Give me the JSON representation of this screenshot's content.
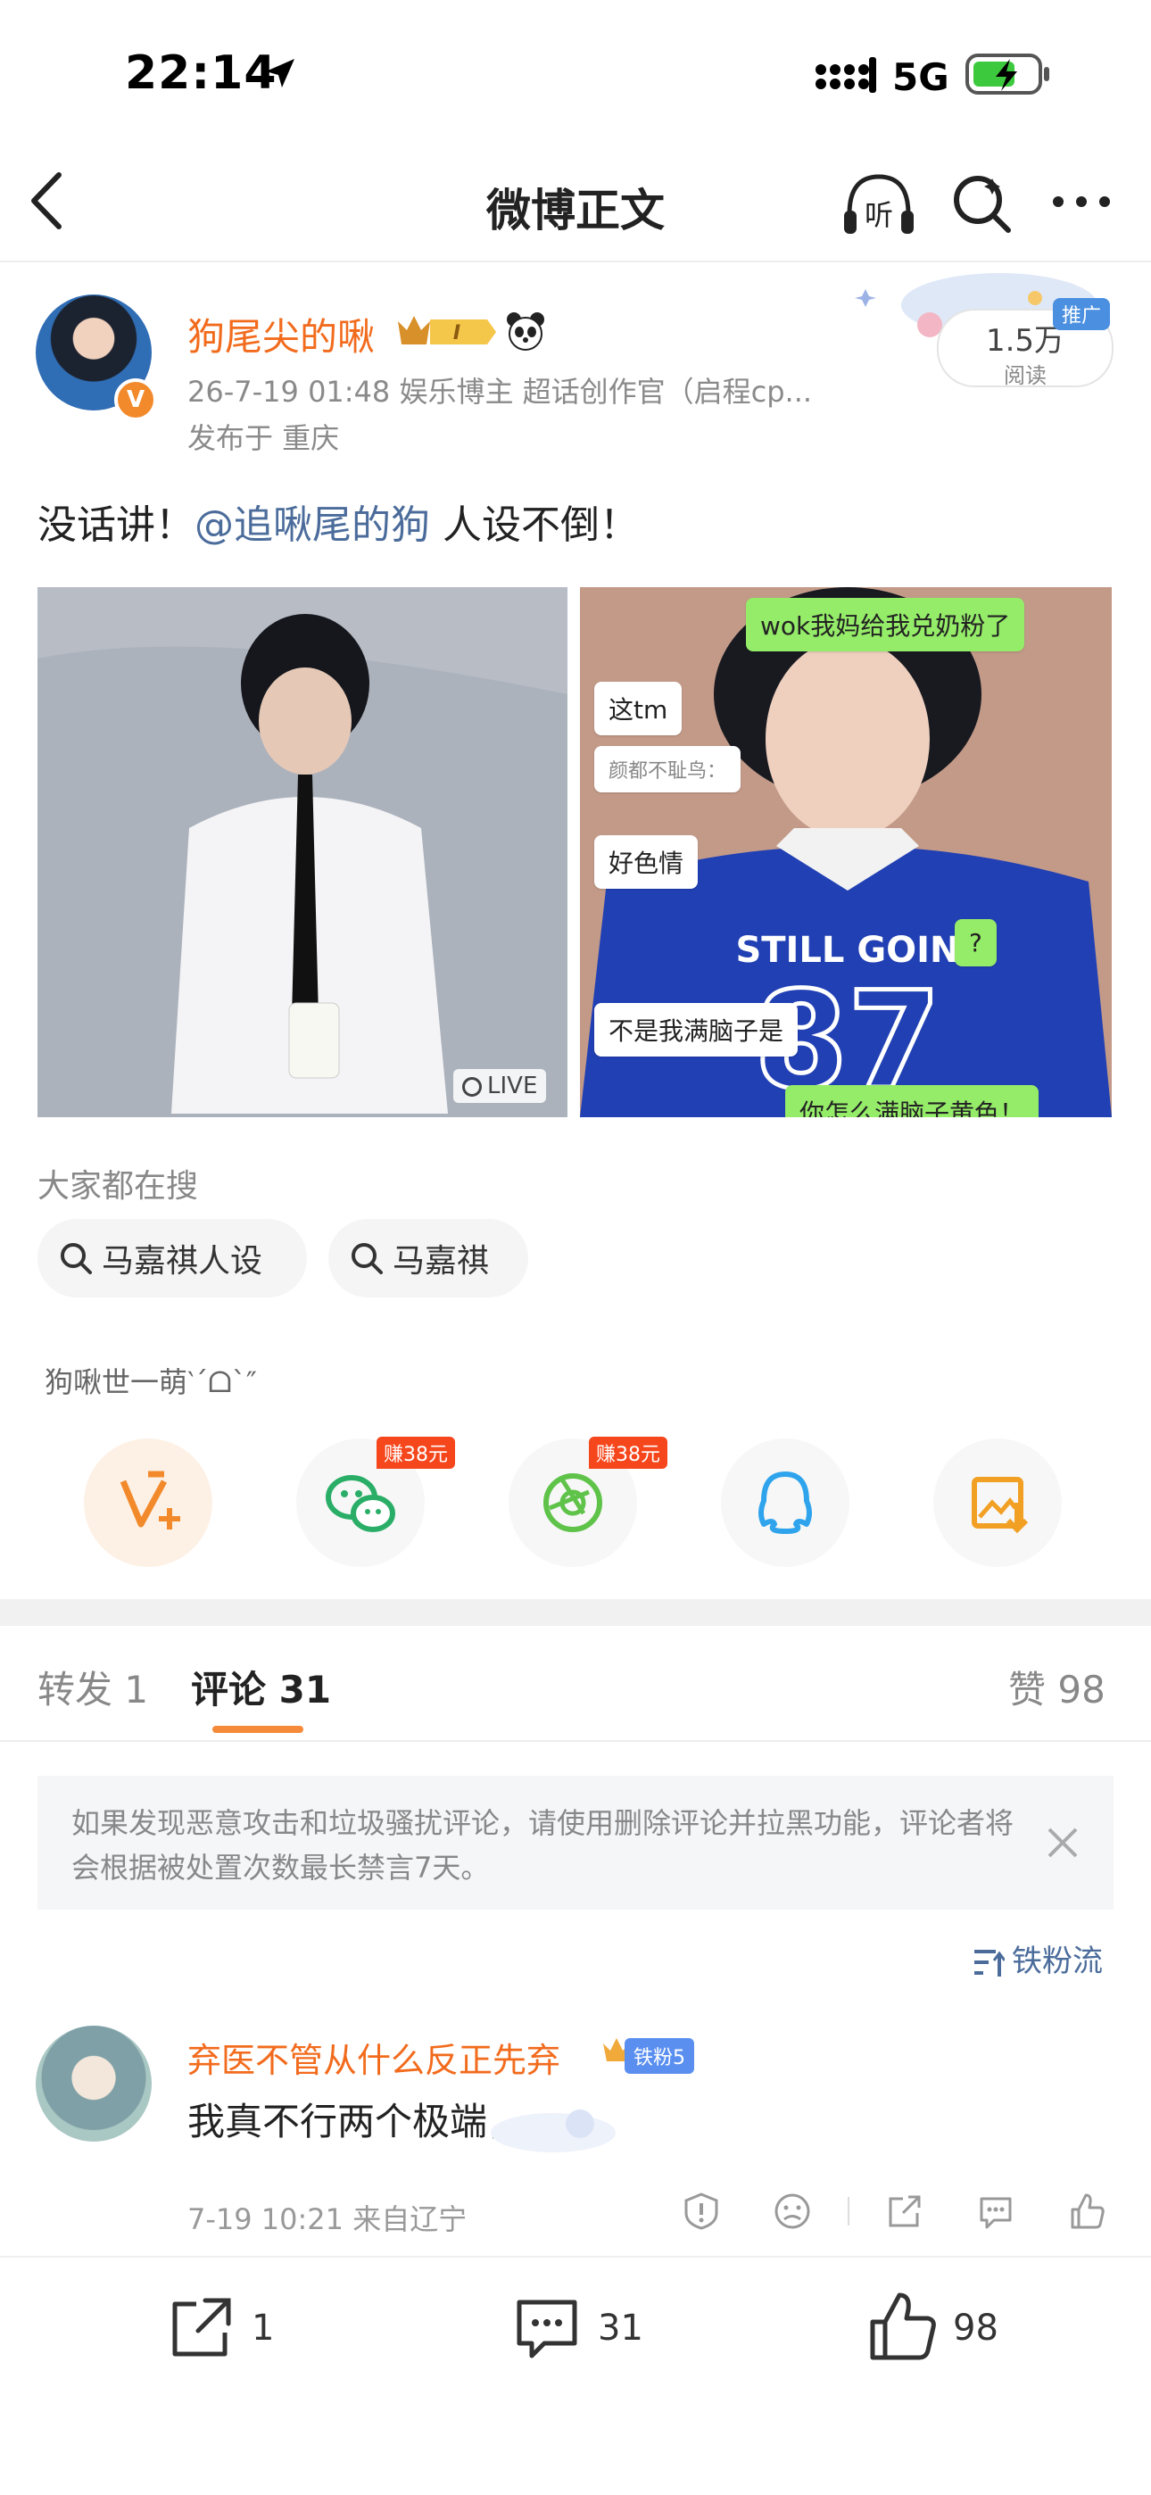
{
  "status_bar": {
    "time": "22:14",
    "network": "5G"
  },
  "nav": {
    "title": "微博正文",
    "listen_label": "听"
  },
  "post": {
    "author": "狗尾尖的啾",
    "meta": "26-7-19 01:48  娱乐博主 超话创作官（启程cp...",
    "location": "发布于 重庆",
    "reads_count": "1.5万",
    "reads_label": "阅读",
    "ad_tag": "推广",
    "text_before": "没话讲！",
    "mention": "@追啾尾的狗",
    "text_after": " 人设不倒！",
    "live_label": "LIVE",
    "image_right_bubbles": [
      "wok我妈给我兑奶粉了",
      "这tm",
      "颜都不耻鸟：",
      "好色情",
      "?",
      "不是我满脑子是",
      "你怎么满脑子黄色！"
    ],
    "jersey_text": "STILL GOIN",
    "jersey_number": "87"
  },
  "search": {
    "label": "大家都在搜",
    "chips": [
      "马嘉祺人设",
      "马嘉祺"
    ]
  },
  "caption": "狗啾世一萌‵´ᗝ`″",
  "share": {
    "earn_badges": [
      "赚38元",
      "赚38元"
    ],
    "icons": [
      "vplus-icon",
      "wechat-icon",
      "moments-icon",
      "qq-icon",
      "save-image-icon"
    ]
  },
  "tabs": {
    "repost": "转发 1",
    "comments": "评论 31",
    "likes": "赞 98"
  },
  "notice": {
    "text": "如果发现恶意攻击和垃圾骚扰评论，请使用删除评论并拉黑功能，评论者将会根据被处置次数最长禁言7天。"
  },
  "sort": {
    "label": "铁粉流"
  },
  "comment": {
    "author": "弃医不管从什么反正先弃",
    "fan_badge": "铁粉5",
    "text": "我真不行两个极端，",
    "meta": "7-19 10:21 来自辽宁"
  },
  "bottom_bar": {
    "repost_count": "1",
    "comment_count": "31",
    "like_count": "98"
  },
  "colors": {
    "accent_orange": "#f26b1d",
    "link_blue": "#4b6c9b",
    "badge_red": "#f5461c",
    "tab_underline": "#f58a3a"
  }
}
